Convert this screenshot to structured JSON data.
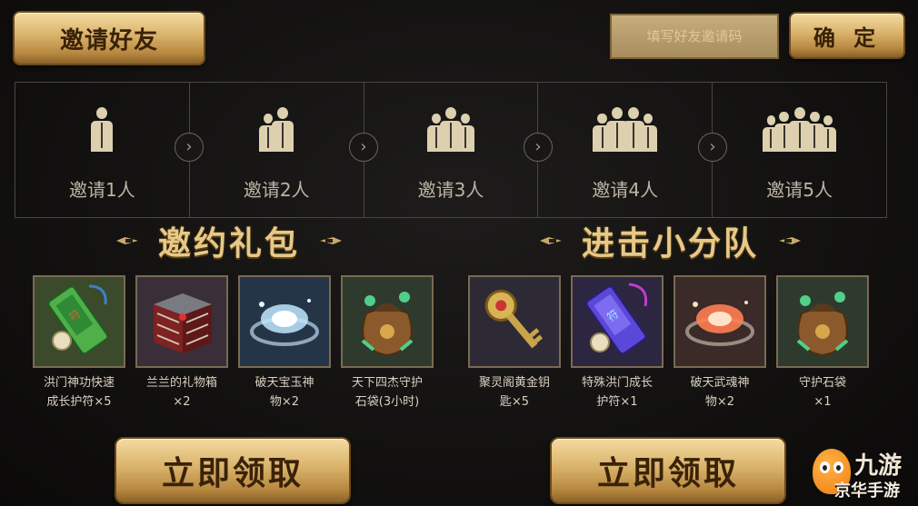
{
  "header": {
    "invite_button": "邀请好友",
    "code_placeholder": "填写好友邀请码",
    "confirm_button": "确 定"
  },
  "steps": [
    {
      "label": "邀请1人",
      "people": 1
    },
    {
      "label": "邀请2人",
      "people": 2
    },
    {
      "label": "邀请3人",
      "people": 3
    },
    {
      "label": "邀请4人",
      "people": 4
    },
    {
      "label": "邀请5人",
      "people": 5
    }
  ],
  "sections": [
    {
      "title": "邀约礼包",
      "claim_button": "立即领取",
      "items": [
        {
          "icon": "green-talisman-icon",
          "line1": "洪门神功快速",
          "line2": "成长护符×5"
        },
        {
          "icon": "gift-box-icon",
          "line1": "兰兰的礼物箱",
          "line2": "×2"
        },
        {
          "icon": "blue-jade-icon",
          "line1": "破天宝玉神",
          "line2": "物×2"
        },
        {
          "icon": "stone-bag-icon",
          "line1": "天下四杰守护",
          "line2": "石袋(3小时)"
        }
      ]
    },
    {
      "title": "进击小分队",
      "claim_button": "立即领取",
      "items": [
        {
          "icon": "golden-key-icon",
          "line1": "聚灵阁黄金钥",
          "line2": "匙×5"
        },
        {
          "icon": "purple-talisman-icon",
          "line1": "特殊洪门成长",
          "line2": "护符×1"
        },
        {
          "icon": "red-soul-icon",
          "line1": "破天武魂神",
          "line2": "物×2"
        },
        {
          "icon": "stone-bag-icon",
          "line1": "守护石袋",
          "line2": "×1"
        }
      ]
    }
  ],
  "watermark": {
    "line1": "九游",
    "line2": "京华手游"
  }
}
